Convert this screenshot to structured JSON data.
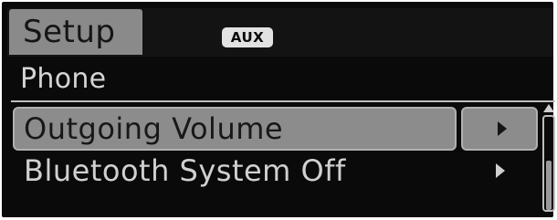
{
  "header": {
    "tab_label": "Setup",
    "source_badge": "AUX"
  },
  "section": {
    "title": "Phone"
  },
  "menu": {
    "items": [
      {
        "label": "Outgoing Volume",
        "selected": true,
        "arrow_icon": "chevron-right-icon"
      },
      {
        "label": "Bluetooth System Off",
        "selected": false,
        "arrow_icon": "chevron-right-icon"
      }
    ]
  },
  "scrollbar": {
    "up_icon": "scroll-up-arrow-icon",
    "position_fraction": 0.5
  },
  "colors": {
    "screen_background": "#0a0a0a",
    "highlight": "#8c8c8c",
    "text_light": "#d0d0d0",
    "badge_background": "#e2e2e2"
  }
}
